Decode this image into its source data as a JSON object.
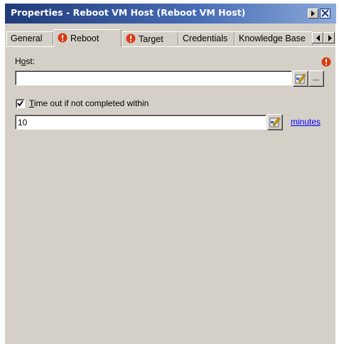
{
  "window": {
    "title": "Properties - Reboot VM Host (Reboot VM Host)"
  },
  "tabs": [
    {
      "label": "General",
      "active": false,
      "warning": false
    },
    {
      "label": "Reboot",
      "active": true,
      "warning": true
    },
    {
      "label": "Target",
      "active": false,
      "warning": true
    },
    {
      "label": "Credentials",
      "active": false,
      "warning": false
    },
    {
      "label": "Knowledge Base",
      "active": false,
      "warning": false
    }
  ],
  "host": {
    "label_prefix": "H",
    "label_underlined": "o",
    "label_suffix": "st:",
    "value": "",
    "browse_label": "...",
    "required_warning": true
  },
  "timeout": {
    "checked": true,
    "label_underlined": "T",
    "label_rest": "ime out if not completed within",
    "value": "10",
    "units_link": "minutes"
  },
  "colors": {
    "titlebar_start": "#1f3b7a",
    "dialog_bg": "#d4d0c8",
    "warning_red": "#d83a14",
    "link": "#0000ff"
  },
  "icons": {
    "minimize": "arrow-right-icon",
    "close": "close-icon",
    "warning": "warning-circle-icon",
    "edit": "edit-variable-icon"
  }
}
